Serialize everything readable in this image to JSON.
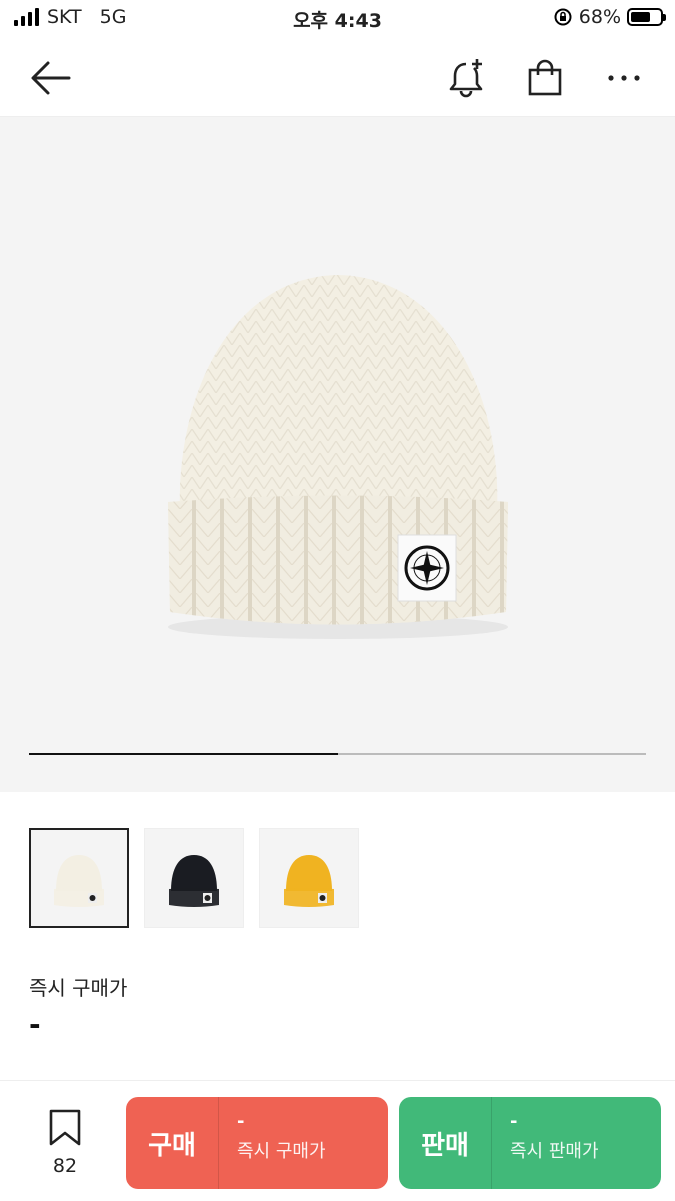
{
  "status_bar": {
    "carrier": "SKT",
    "network": "5G",
    "time": "오후 4:43",
    "battery_percent": "68%",
    "battery_level": 0.68
  },
  "nav": {
    "icons": [
      "back-arrow-icon",
      "bell-plus-icon",
      "shopping-bag-icon",
      "more-icon"
    ]
  },
  "product": {
    "image_colors": [
      "#f3efe3",
      "#1a1c22",
      "#f0b321"
    ],
    "thumbnails": [
      {
        "color": "#f3efe3",
        "selected": true
      },
      {
        "color": "#1a1c22",
        "selected": false
      },
      {
        "color": "#f0b321",
        "selected": false
      }
    ],
    "image_progress": 0.5
  },
  "price": {
    "label": "즉시 구매가",
    "value": "-"
  },
  "bottom_bar": {
    "wish_count": "82",
    "buy": {
      "label": "구매",
      "price": "-",
      "sub_label": "즉시 구매가",
      "color": "#ef6253"
    },
    "sell": {
      "label": "판매",
      "price": "-",
      "sub_label": "즉시 판매가",
      "color": "#41b979"
    }
  }
}
